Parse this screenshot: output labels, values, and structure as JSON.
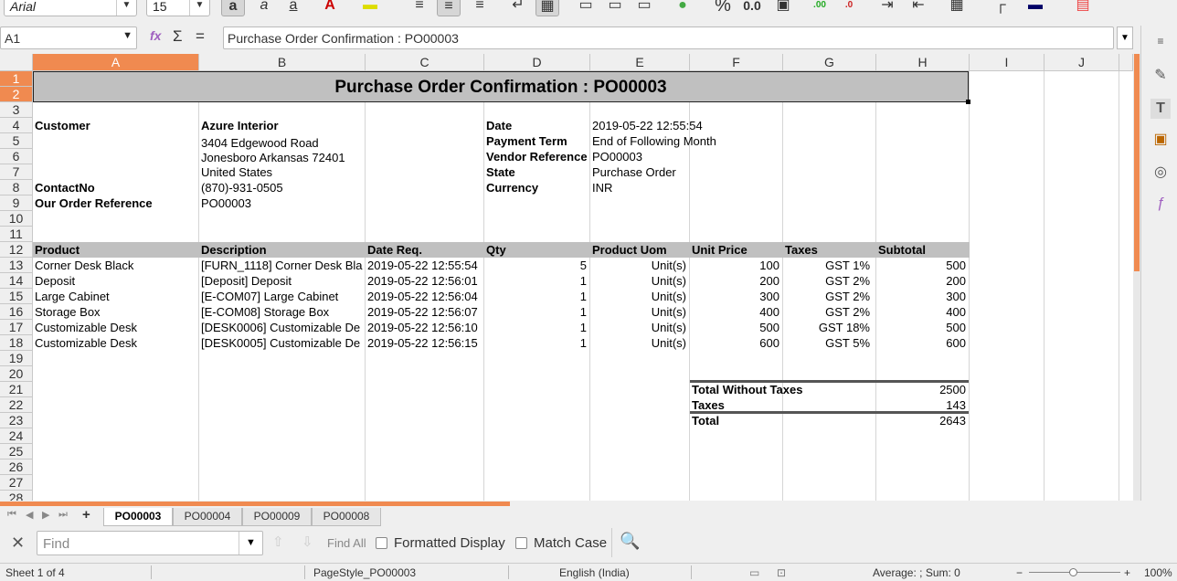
{
  "toolbar": {
    "font_name": "Arial",
    "font_size": "15",
    "percent": "%",
    "decimals": "0.0",
    "add_decimal": ".00",
    "del_decimal": ".0"
  },
  "formula_bar": {
    "cell_ref": "A1",
    "formula": "Purchase Order Confirmation : PO00003",
    "func_icon": "fx",
    "sum_icon": "Σ",
    "equals_icon": "="
  },
  "columns": [
    "A",
    "B",
    "C",
    "D",
    "E",
    "F",
    "G",
    "H",
    "I",
    "J"
  ],
  "rows": [
    "1",
    "2",
    "3",
    "4",
    "5",
    "6",
    "7",
    "8",
    "9",
    "10",
    "11",
    "12",
    "13",
    "14",
    "15",
    "16",
    "17",
    "18",
    "19",
    "20",
    "21",
    "22",
    "23",
    "24",
    "25",
    "26",
    "27",
    "28"
  ],
  "sheet": {
    "title": "Purchase Order Confirmation : PO00003",
    "customer_label": "Customer",
    "customer": "Azure Interior",
    "address1": "3404  Edgewood Road",
    "address2": "Jonesboro Arkansas 72401",
    "address3": "United States",
    "contact_label": "ContactNo",
    "contact": "(870)-931-0505",
    "ourref_label": "Our Order Reference",
    "ourref": "PO00003",
    "date_label": "Date",
    "date": "2019-05-22 12:55:54",
    "payterm_label": "Payment Term",
    "payterm": "End of Following Month",
    "vendorref_label": "Vendor Reference",
    "vendorref": "PO00003",
    "state_label": "State",
    "state": "Purchase Order",
    "currency_label": "Currency",
    "currency": "INR"
  },
  "table": {
    "headers": [
      "Product",
      "Description",
      "Date Req.",
      "Qty",
      "Product Uom",
      "Unit Price",
      "Taxes",
      "Subtotal"
    ],
    "rows": [
      [
        "Corner Desk Black",
        "[FURN_1118] Corner Desk Bla",
        "2019-05-22 12:55:54",
        "5",
        "Unit(s)",
        "100",
        "GST 1%",
        "500"
      ],
      [
        "Deposit",
        "[Deposit] Deposit",
        "2019-05-22 12:56:01",
        "1",
        "Unit(s)",
        "200",
        "GST 2%",
        "200"
      ],
      [
        "Large Cabinet",
        "[E-COM07] Large Cabinet",
        "2019-05-22 12:56:04",
        "1",
        "Unit(s)",
        "300",
        "GST 2%",
        "300"
      ],
      [
        "Storage Box",
        "[E-COM08] Storage Box",
        "2019-05-22 12:56:07",
        "1",
        "Unit(s)",
        "400",
        "GST 2%",
        "400"
      ],
      [
        "Customizable Desk",
        "[DESK0006] Customizable De",
        "2019-05-22 12:56:10",
        "1",
        "Unit(s)",
        "500",
        "GST 18%",
        "500"
      ],
      [
        "Customizable Desk",
        "[DESK0005] Customizable De",
        "2019-05-22 12:56:15",
        "1",
        "Unit(s)",
        "600",
        "GST 5%",
        "600"
      ]
    ]
  },
  "totals": {
    "without_label": "Total Without Taxes",
    "without": "2500",
    "taxes_label": "Taxes",
    "taxes": "143",
    "total_label": "Total",
    "total": "2643"
  },
  "tabs": {
    "add": "+",
    "items": [
      "PO00003",
      "PO00004",
      "PO00009",
      "PO00008"
    ]
  },
  "find": {
    "placeholder": "Find",
    "find_all": "Find All",
    "formatted": "Formatted Display",
    "match_case": "Match Case"
  },
  "status": {
    "sheet": "Sheet 1 of 4",
    "style": "PageStyle_PO00003",
    "lang": "English (India)",
    "summary": "Average: ; Sum: 0",
    "zoom": "100%",
    "minus": "−",
    "plus": "+"
  },
  "colors": {
    "accent": "#f08a50",
    "header_fill": "#c0c0c0"
  }
}
